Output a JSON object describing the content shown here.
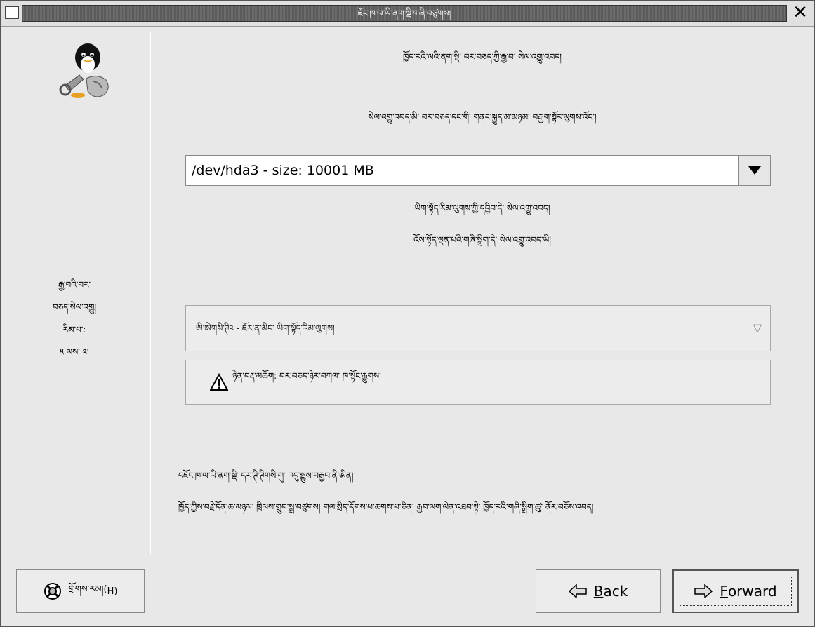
{
  "window": {
    "title": "ཇོང་ཁ་ལ་ཡི་ནག་སྡི་གཞི་བཙུགས།"
  },
  "sidebar": {
    "steps": [
      "རྒྱ་བའི་བར་",
      "བཅད་སེལ་འགྱུ།",
      "རིམ་པ་:",
      "༥ ལས་ ༢།"
    ]
  },
  "main": {
    "heading": "ཁྱོད་རའི་ལའི་ནག་སྡི་ བར་བཅད་ཀྱི་རྒྱ་བ་ སེལ་འགྱུ་འབད།",
    "subheading": "སེལ་འགྱུ་འབད་མི་ བར་བཅད་དང་གི་ གནང་སྐྱུད་མ་མཉམ་ བརྒྱག་སྟོར་ལུགས་འོང་།",
    "partition_combo": {
      "value": "/dev/hda3 - size: 10001 MB"
    },
    "line1": "ཡིག་སྟོད་རིམ་ལུགས་ཀྱི་དབྱིབ་དེ་ སེལ་འགྱུ་འབད།",
    "line2": "འོས་སྟོད་ལྡན་པའི་གཞི་སྒྲིག་དེ་ སེལ་འགྱུ་འབད་ཡི།",
    "filesystem_select": {
      "value": "ཨི་ཨེགསི་ཊི༢ - ཇོར་ན་མིང་ ཡིག་སྟོད་རིམ་ལུགས།"
    },
    "warning_text": "ཉེན་བརྡ་མཆོག: བར་བཅད་ཉེར་བཀལ་ ཁ་སྟོང་རྒྱུགས།",
    "footer_line1": "དཇོང་ཁ་ལ་ཡི་ནག་སྡི་ དར་ཊི་ཊིགསི་གུ་ འདུ་སྦྱུས་བརྒྱབ་ནི་ཨིན།",
    "footer_line2": "ཁྱོད་ཀྱིས་བརྗེ་དོན་ཆ་མཉམ་ ཁྲིམས་གྲུབ་སྒྲ་བཙུགས། གལ་སྲིད་དོགས་པ་ཆགས་པ་ཅིན་ རྒྱབ་ལག་ལེན་འཐབ་སྟེ་ ཁྱོད་རའི་གཞི་སྒྲིག་ཚུ་ ནོར་བཅོས་འབད།"
  },
  "buttons": {
    "help_label": "གྲོགས་རམ།(",
    "help_key": "H",
    "help_tail": ")",
    "back_key": "B",
    "back_rest": "ack",
    "forward_key": "F",
    "forward_rest": "orward"
  },
  "icons": {
    "menu": "window-menu-icon",
    "close": "close-icon",
    "mascot": "tux-mascot-icon",
    "combo_arrow": "dropdown-arrow-icon",
    "select_arrow": "triangle-down-icon",
    "warning": "warning-icon",
    "help": "lifebuoy-icon",
    "back": "arrow-left-icon",
    "forward": "arrow-right-icon"
  }
}
